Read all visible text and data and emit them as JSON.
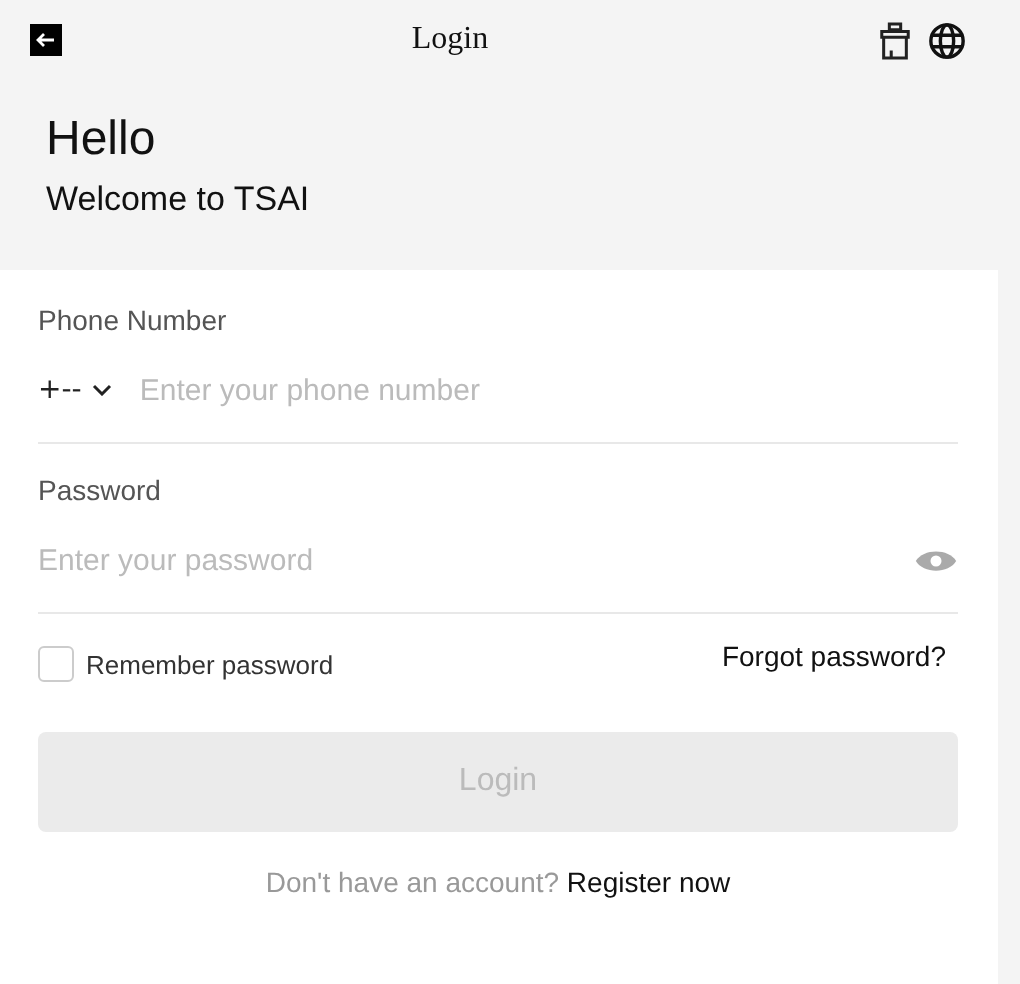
{
  "header": {
    "title": "Login"
  },
  "greeting": {
    "title": "Hello",
    "subtitle": "Welcome to TSAI"
  },
  "phone": {
    "label": "Phone Number",
    "country_code": "+--",
    "placeholder": "Enter your phone number"
  },
  "password": {
    "label": "Password",
    "placeholder": "Enter your password"
  },
  "remember": {
    "label": "Remember password",
    "checked": false
  },
  "forgot_link": "Forgot password?",
  "login_button": {
    "label": "Login",
    "disabled": true
  },
  "register": {
    "prompt": "Don't have an account?",
    "link": "Register now"
  }
}
